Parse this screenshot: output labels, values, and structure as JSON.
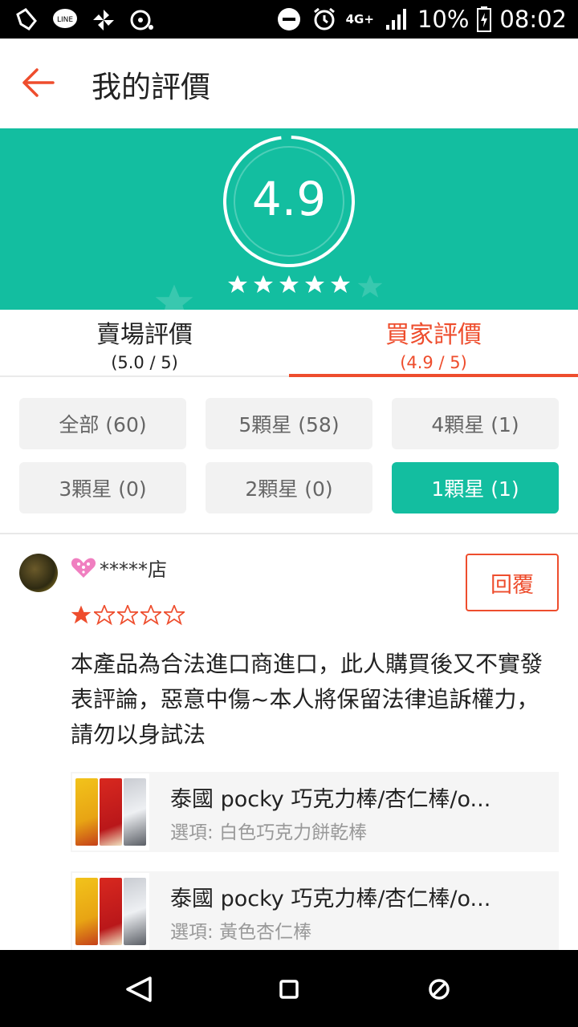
{
  "status_bar": {
    "battery": "10%",
    "time": "08:02",
    "network": "4G+",
    "icons": [
      "notification-icon",
      "line-icon",
      "pinwheel-icon",
      "media-icon",
      "do-not-disturb-icon",
      "alarm-icon",
      "signal-icon",
      "battery-icon"
    ]
  },
  "header": {
    "title": "我的評價",
    "back_icon": "arrow-left-icon"
  },
  "hero": {
    "score": "4.9",
    "star_count": 5,
    "bg_color": "#13bea0"
  },
  "tabs": [
    {
      "label": "賣場評價",
      "sub": "(5.0 / 5)",
      "active": false
    },
    {
      "label": "買家評價",
      "sub": "(4.9 / 5)",
      "active": true
    }
  ],
  "filters": [
    {
      "label": "全部 (60)",
      "selected": false
    },
    {
      "label": "5顆星 (58)",
      "selected": false
    },
    {
      "label": "4顆星 (1)",
      "selected": false
    },
    {
      "label": "3顆星 (0)",
      "selected": false
    },
    {
      "label": "2顆星 (0)",
      "selected": false
    },
    {
      "label": "1顆星 (1)",
      "selected": true
    }
  ],
  "review": {
    "username": "*****店",
    "reply_label": "回覆",
    "rating": 1,
    "max_rating": 5,
    "comment": "本產品為合法進口商進口，此人購買後又不實發表評論，惡意中傷~本人將保留法律追訴權力，請勿以身試法",
    "products": [
      {
        "name": "泰國 pocky 巧克力棒/杏仁棒/o...",
        "option_label": "選項:",
        "option_value": "白色巧克力餅乾棒"
      },
      {
        "name": "泰國 pocky 巧克力棒/杏仁棒/o...",
        "option_label": "選項:",
        "option_value": "黃色杏仁棒"
      }
    ]
  },
  "colors": {
    "accent": "#ee4d2d",
    "teal": "#13bea0",
    "star": "#ee4d2d"
  },
  "nav": {
    "icons": [
      "back-triangle-icon",
      "home-square-icon",
      "recents-icon"
    ]
  }
}
